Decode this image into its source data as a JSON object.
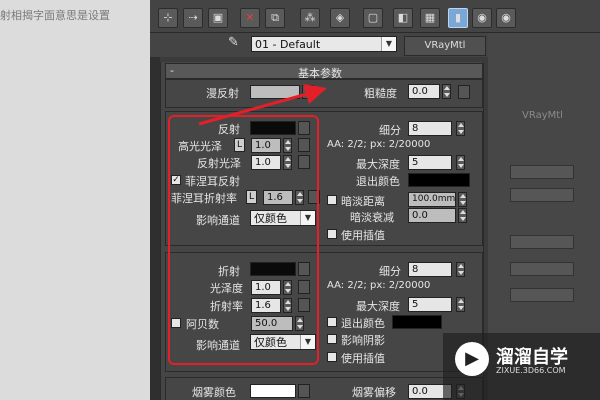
{
  "caption": {
    "text": "射相揭字面意思是设置"
  },
  "toolbar": {
    "icons": [
      "sample-spheres-icon",
      "assign-material-icon",
      "reset-map-icon",
      "delete-icon",
      "copy-material-icon",
      "unique-icon",
      "put-to-library-icon",
      "material-effects-icon",
      "show-map-icon",
      "background-icon",
      "vertical-bar-icon",
      "go-parent-icon",
      "go-forward-icon"
    ],
    "glyphs": [
      "⊹",
      "⇢",
      "▣",
      "✕",
      "⧉",
      "⁂",
      "◈",
      "▢",
      "◧",
      "▦",
      "▮",
      "◉",
      "◉"
    ]
  },
  "material": {
    "name": "01 - Default",
    "type": "VRayMtl",
    "eyedropper_glyph": "✎"
  },
  "rollout": {
    "minus": "-",
    "title": "基本参数"
  },
  "diffuse": {
    "label": "漫反射",
    "color": "#bdbdbd",
    "roughness_label": "粗糙度",
    "roughness_value": "0.0"
  },
  "reflection": {
    "label": "反射",
    "color": "#0a0a0a",
    "hilight_gloss_label": "高光光泽",
    "hilight_gloss_lock": "L",
    "hilight_gloss_value": "1.0",
    "refl_gloss_label": "反射光泽",
    "refl_gloss_value": "1.0",
    "fresnel_label": "菲涅耳反射",
    "fresnel_checked": "✓",
    "fresnel_ior_label": "菲涅耳折射率",
    "fresnel_ior_lock": "L",
    "fresnel_ior_value": "1.6",
    "affect_channels_label": "影响通道",
    "affect_channels_value": "仅颜色",
    "subdivs_label": "细分",
    "subdivs_value": "8",
    "aa_text": "AA: 2/2; px: 2/20000",
    "max_depth_label": "最大深度",
    "max_depth_value": "5",
    "exit_color_label": "退出颜色",
    "exit_color": "#000000",
    "dim_distance_label": "暗淡距离",
    "dim_distance_value": "100.0mm",
    "dim_falloff_label": "暗淡衰减",
    "dim_falloff_value": "0.0",
    "use_interp_label": "使用插值"
  },
  "refraction": {
    "label": "折射",
    "color": "#0a0a0a",
    "gloss_label": "光泽度",
    "gloss_value": "1.0",
    "ior_label": "折射率",
    "ior_value": "1.6",
    "abbe_label": "阿贝数",
    "abbe_value": "50.0",
    "affect_channels_label": "影响通道",
    "affect_channels_value": "仅颜色",
    "subdivs_label": "细分",
    "subdivs_value": "8",
    "aa_text": "AA: 2/2; px: 2/20000",
    "max_depth_label": "最大深度",
    "max_depth_value": "5",
    "exit_color_label": "退出颜色",
    "exit_color": "#000000",
    "affect_shadows_label": "影响阴影",
    "use_interp_label": "使用插值"
  },
  "fog": {
    "color_label": "烟雾颜色",
    "color": "#ffffff",
    "bias_label": "烟雾偏移",
    "bias_value": "0.0"
  },
  "background": {
    "vraymtl_label": "VRayMtl"
  },
  "watermark": {
    "logo_glyph": "▶",
    "title": "溜溜自学",
    "subtitle": "ZIXUE.3D66.COM"
  },
  "colors": {
    "annotation_red": "#e3202a",
    "highlight_blue": "#7aa7d6"
  }
}
